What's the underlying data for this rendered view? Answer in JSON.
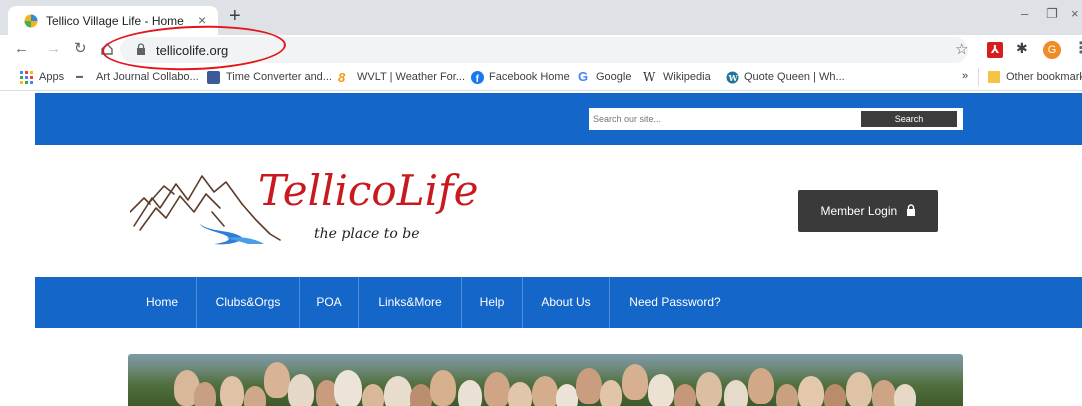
{
  "browser": {
    "tab_title": "Tellico Village Life - Home",
    "tab_close": "×",
    "new_tab": "+",
    "window_controls": {
      "minimize": "–",
      "restore": "❐",
      "close": "×"
    },
    "url": "tellicolife.org",
    "icons": [
      "back-icon",
      "forward-icon",
      "reload-icon",
      "home-icon",
      "lock-icon",
      "star-icon",
      "pdf-extension-icon",
      "puzzle-icon",
      "profile-avatar",
      "kebab-menu-icon"
    ],
    "avatar_letter": "G",
    "bookmarks": [
      {
        "label": "Apps",
        "icon": "apps-grid-icon"
      },
      {
        "label": "Art Journal Collabo...",
        "icon": "art-journal-icon"
      },
      {
        "label": "Time Converter and...",
        "icon": "time-converter-icon"
      },
      {
        "label": "WVLT | Weather For...",
        "icon": "wvlt-icon"
      },
      {
        "label": "Facebook Home",
        "icon": "facebook-icon"
      },
      {
        "label": "Google",
        "icon": "google-icon"
      },
      {
        "label": "Wikipedia",
        "icon": "wikipedia-icon"
      },
      {
        "label": "Quote Queen | Wh...",
        "icon": "wordpress-icon"
      }
    ],
    "bookmarks_overflow": "»",
    "other_bookmarks": "Other bookmarks"
  },
  "site": {
    "search_placeholder": "Search our site...",
    "search_button": "Search",
    "logo_text": "TellicoLife",
    "logo_tagline": "the place to be",
    "member_login": "Member Login",
    "nav": [
      "Home",
      "Clubs&Orgs",
      "POA",
      "Links&More",
      "Help",
      "About Us",
      "Need Password?"
    ]
  },
  "colors": {
    "site_blue": "#1466c8",
    "logo_red": "#c8191f",
    "dark_button": "#3a3a3a",
    "annotation_red": "#e3161b"
  }
}
